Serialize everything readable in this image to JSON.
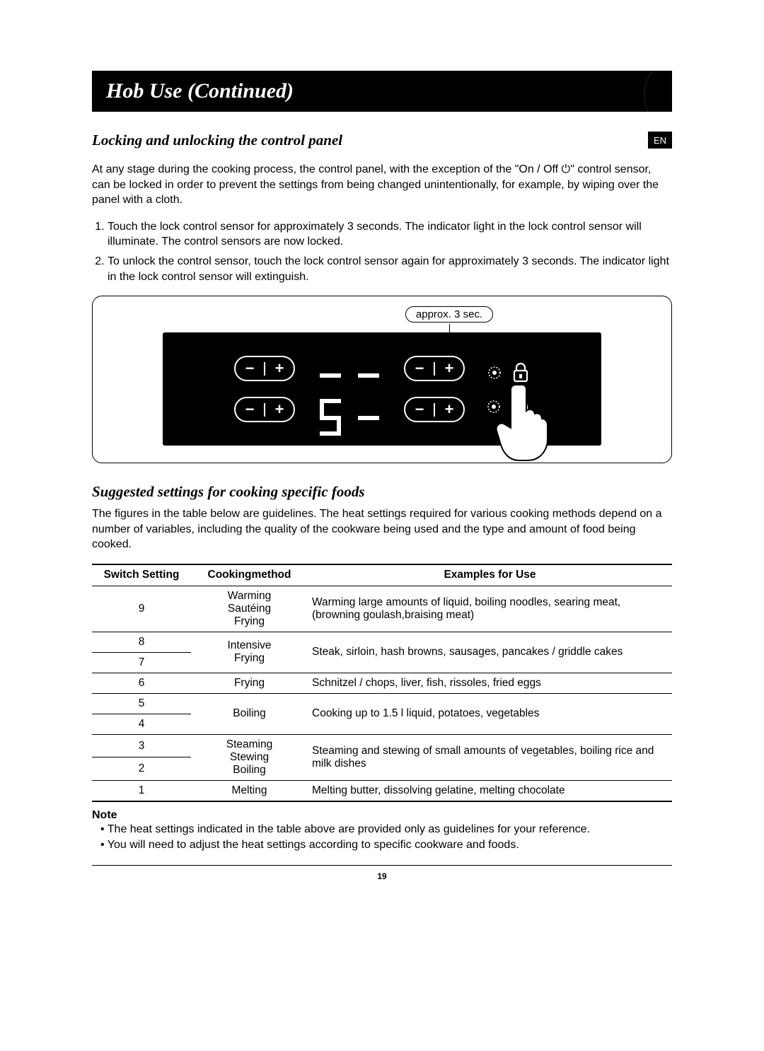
{
  "header": {
    "title": "Hob Use (Continued)"
  },
  "lang_badge": "EN",
  "section1": {
    "heading": "Locking and unlocking the control panel",
    "intro": "At any stage during the cooking process, the control panel, with the exception of the \"On / Off ⏻\" control sensor, can be locked in order to prevent the settings from being changed unintentionally, for example, by wiping over the panel with a cloth.",
    "steps": [
      "Touch the lock control sensor for approximately 3 seconds.\nThe indicator light in the lock control sensor will illuminate. The control sensors are now locked.",
      "To unlock the control sensor, touch the lock control sensor again for approximately 3 seconds. The indicator light in the lock control sensor will extinguish."
    ],
    "callout": "approx. 3 sec."
  },
  "section2": {
    "heading": "Suggested settings for cooking specific foods",
    "intro": "The figures in the table below are guidelines. The heat settings required for various cooking methods depend on a number of variables, including the quality of the cookware being used and the type and amount of food being cooked."
  },
  "table": {
    "headers": [
      "Switch Setting",
      "Cookingmethod",
      "Examples for Use"
    ],
    "rows": {
      "r9": {
        "sw": "9",
        "cm": "Warming\nSautéing\nFrying",
        "ex": "Warming large amounts of liquid, boiling noodles, searing meat, (browning goulash,braising meat)"
      },
      "r8": {
        "sw": "8"
      },
      "r7": {
        "sw": "7"
      },
      "r87_cm": "Intensive\nFrying",
      "r87_ex": "Steak, sirloin, hash browns, sausages, pancakes / griddle cakes",
      "r6": {
        "sw": "6",
        "cm": "Frying",
        "ex": "Schnitzel / chops, liver, fish, rissoles, fried eggs"
      },
      "r5": {
        "sw": "5"
      },
      "r4": {
        "sw": "4"
      },
      "r54_cm": "Boiling",
      "r54_ex": "Cooking up to 1.5 l liquid, potatoes, vegetables",
      "r3": {
        "sw": "3"
      },
      "r2": {
        "sw": "2"
      },
      "r32_cm": "Steaming\nStewing\nBoiling",
      "r32_ex": "Steaming and stewing of small amounts of vegetables, boiling rice and milk dishes",
      "r1": {
        "sw": "1",
        "cm": "Melting",
        "ex": "Melting butter, dissolving gelatine, melting chocolate"
      }
    }
  },
  "note": {
    "label": "Note",
    "items": [
      "The heat settings indicated in the table above are provided only as guidelines for your reference.",
      "You will need to adjust the heat settings according to specific cookware and foods."
    ]
  },
  "page_number": "19",
  "chart_data": {
    "type": "table",
    "title": "Suggested heat settings by cooking method",
    "columns": [
      "Switch Setting",
      "Cookingmethod",
      "Examples for Use"
    ],
    "rows": [
      [
        9,
        "Warming / Sautéing / Frying",
        "Warming large amounts of liquid, boiling noodles, searing meat, (browning goulash, braising meat)"
      ],
      [
        8,
        "Intensive Frying",
        "Steak, sirloin, hash browns, sausages, pancakes / griddle cakes"
      ],
      [
        7,
        "Intensive Frying",
        "Steak, sirloin, hash browns, sausages, pancakes / griddle cakes"
      ],
      [
        6,
        "Frying",
        "Schnitzel / chops, liver, fish, rissoles, fried eggs"
      ],
      [
        5,
        "Boiling",
        "Cooking up to 1.5 l liquid, potatoes, vegetables"
      ],
      [
        4,
        "Boiling",
        "Cooking up to 1.5 l liquid, potatoes, vegetables"
      ],
      [
        3,
        "Steaming / Stewing / Boiling",
        "Steaming and stewing of small amounts of vegetables, boiling rice and milk dishes"
      ],
      [
        2,
        "Steaming / Stewing / Boiling",
        "Steaming and stewing of small amounts of vegetables, boiling rice and milk dishes"
      ],
      [
        1,
        "Melting",
        "Melting butter, dissolving gelatine, melting chocolate"
      ]
    ]
  }
}
